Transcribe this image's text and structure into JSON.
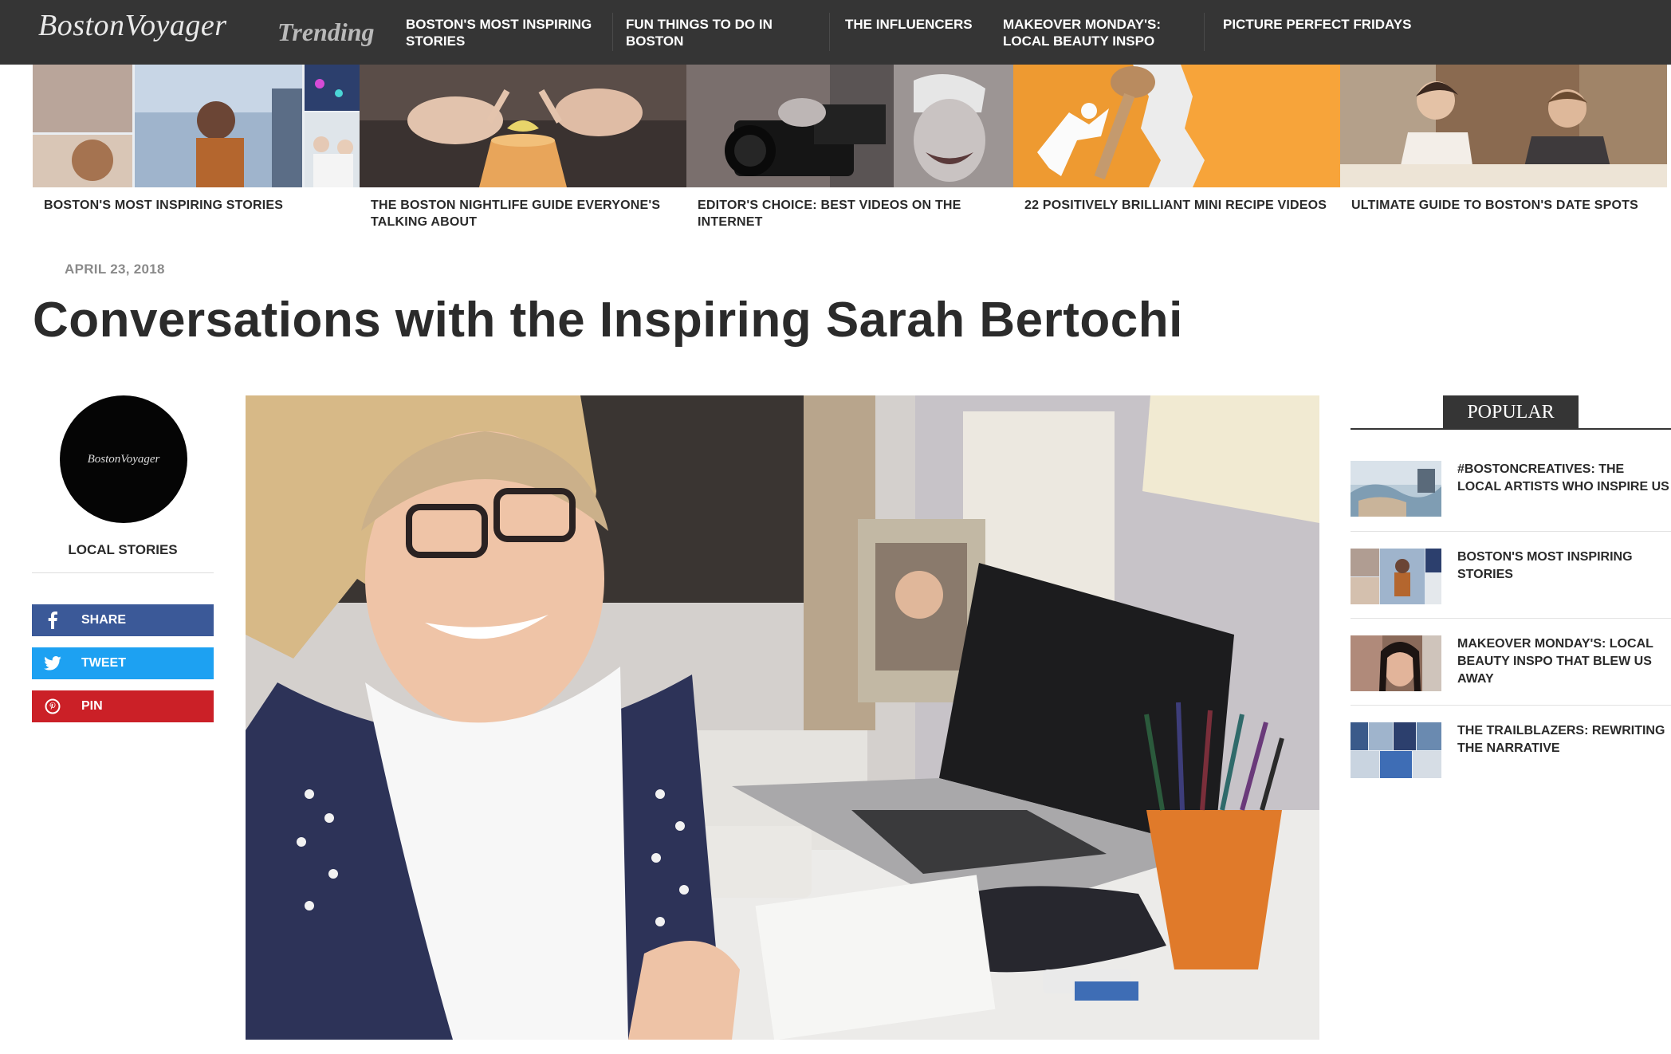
{
  "site": {
    "logo": "BostonVoyager",
    "trending_label": "Trending"
  },
  "nav": [
    {
      "label": "BOSTON'S MOST INSPIRING STORIES"
    },
    {
      "label": "FUN THINGS TO DO IN BOSTON"
    },
    {
      "label": "THE INFLUENCERS"
    },
    {
      "label": "MAKEOVER MONDAY'S: LOCAL BEAUTY INSPO"
    },
    {
      "label": "PICTURE PERFECT FRIDAYS"
    }
  ],
  "strip": [
    {
      "caption": "BOSTON'S MOST INSPIRING STORIES"
    },
    {
      "caption": "THE BOSTON NIGHTLIFE GUIDE EVERYONE'S TALKING ABOUT"
    },
    {
      "caption": "EDITOR'S CHOICE: BEST VIDEOS ON THE INTERNET"
    },
    {
      "caption": "22 POSITIVELY BRILLIANT MINI RECIPE VIDEOS"
    },
    {
      "caption": "ULTIMATE GUIDE TO BOSTON'S DATE SPOTS"
    }
  ],
  "article": {
    "date": "APRIL 23, 2018",
    "title": "Conversations with the Inspiring Sarah Bertochi"
  },
  "author": {
    "avatar_text": "BostonVoyager",
    "name": "LOCAL STORIES"
  },
  "share": {
    "facebook": {
      "label": "SHARE",
      "icon": "facebook-icon",
      "color": "#3b5998"
    },
    "twitter": {
      "label": "TWEET",
      "icon": "twitter-icon",
      "color": "#1da1f2"
    },
    "pinterest": {
      "label": "PIN",
      "icon": "pinterest-icon",
      "color": "#cb2027"
    }
  },
  "popular": {
    "heading": "POPULAR",
    "items": [
      {
        "title": "#BOSTONCREATIVES: THE LOCAL ARTISTS WHO INSPIRE US"
      },
      {
        "title": "BOSTON'S MOST INSPIRING STORIES"
      },
      {
        "title": "MAKEOVER MONDAY'S: LOCAL BEAUTY INSPO THAT BLEW US AWAY"
      },
      {
        "title": "THE TRAILBLAZERS: REWRITING THE NARRATIVE"
      }
    ]
  }
}
